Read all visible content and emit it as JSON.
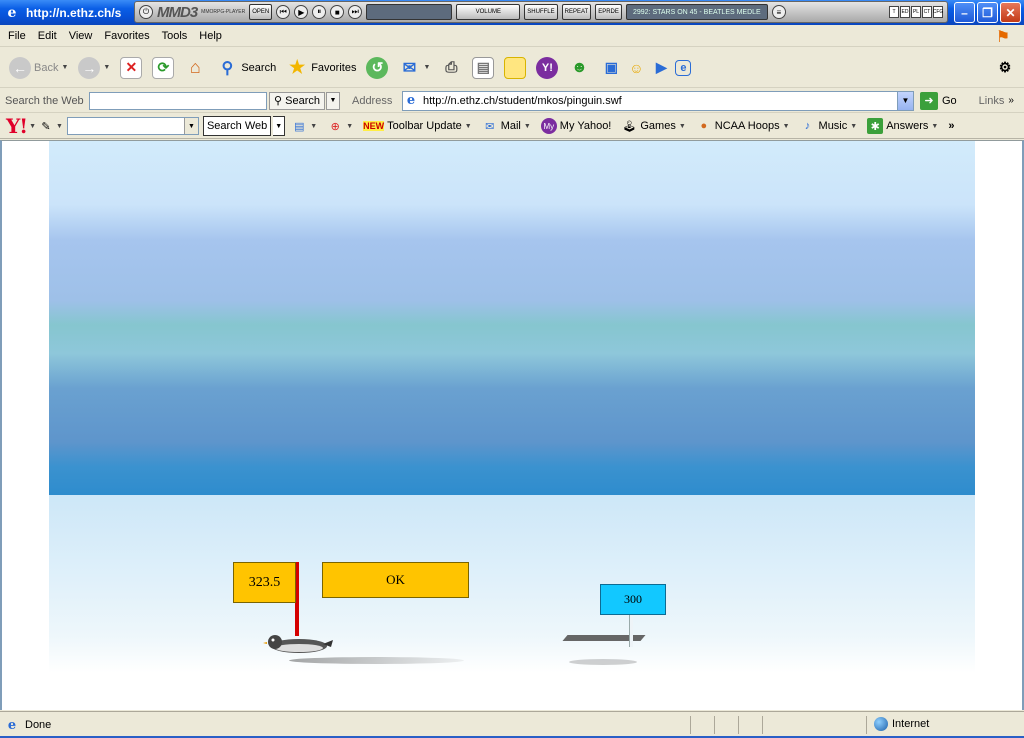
{
  "window": {
    "title": "http://n.ethz.ch/s",
    "minimize_glyph": "–",
    "maximize_glyph": "❐",
    "close_glyph": "✕"
  },
  "media_player": {
    "logo": "MMD3",
    "sub": "MMORPG-PLAYER",
    "open_label": "OPEN",
    "volume_label": "VOLUME",
    "shuffle_label": "SHUFFLE",
    "repeat_label": "REPEAT",
    "eprde_label": "EPRDE",
    "track": "2992: STARS ON 45 - BEATLES MEDLE",
    "ctl_labels": [
      "T",
      "ED",
      "PL",
      "CT",
      "CFG"
    ]
  },
  "menubar": {
    "items": [
      "File",
      "Edit",
      "View",
      "Favorites",
      "Tools",
      "Help"
    ]
  },
  "toolbar": {
    "back": "Back",
    "search": "Search",
    "favorites": "Favorites"
  },
  "search_bar": {
    "label": "Search the Web",
    "input_value": "",
    "button": "Search",
    "address_label": "Address",
    "url": "http://n.ethz.ch/student/mkos/pinguin.swf",
    "go": "Go",
    "links": "Links"
  },
  "yahoo_bar": {
    "logo": "Y!",
    "search_button": "Search Web",
    "new_tag": "NEW",
    "toolbar_update": "Toolbar Update",
    "mail": "Mail",
    "myyahoo": "My Yahoo!",
    "games": "Games",
    "ncaa": "NCAA Hoops",
    "music": "Music",
    "answers": "Answers",
    "more": "»"
  },
  "game": {
    "distance": "323.5",
    "ok": "OK",
    "target": "300"
  },
  "status": {
    "text": "Done",
    "zone": "Internet"
  },
  "colors": {
    "sign_yellow": "#ffc400",
    "target_cyan": "#12c8ff",
    "pole_red": "#d40000",
    "xp_blue": "#0a5ee6"
  },
  "icons": [
    "ie-logo-icon",
    "back-arrow-icon",
    "forward-arrow-icon",
    "stop-icon",
    "refresh-icon",
    "home-icon",
    "search-icon",
    "favorites-star-icon",
    "history-icon",
    "mail-icon",
    "print-icon",
    "edit-icon",
    "notes-icon",
    "yahoo-messenger-icon",
    "messenger-icon",
    "go-arrow-icon",
    "globe-icon"
  ]
}
